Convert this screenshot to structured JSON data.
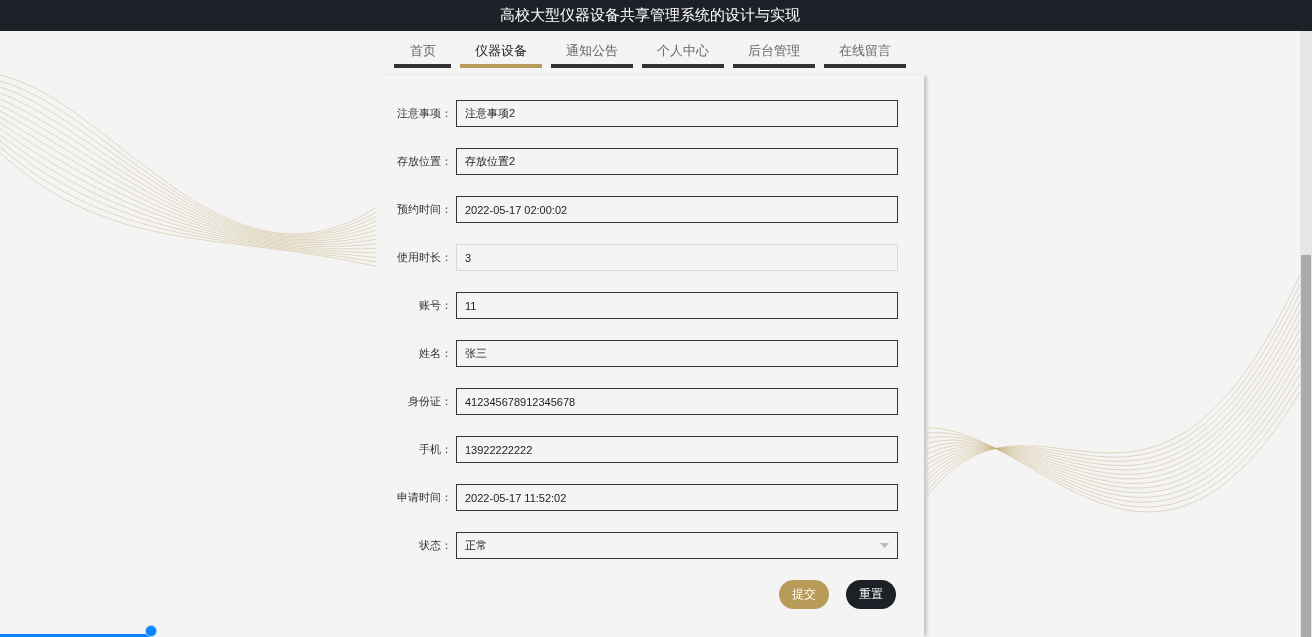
{
  "window": {
    "title": "高校大型仪器设备共享管理系统的设计与实现"
  },
  "tabs": [
    {
      "label": "首页",
      "selected": false
    },
    {
      "label": "仪器设备",
      "selected": true
    },
    {
      "label": "通知公告",
      "selected": false
    },
    {
      "label": "个人中心",
      "selected": false
    },
    {
      "label": "后台管理",
      "selected": false
    },
    {
      "label": "在线留言",
      "selected": false
    }
  ],
  "form": {
    "fields": [
      {
        "label": "注意事项：",
        "value": "注意事项2",
        "kind": "text",
        "readonly": false
      },
      {
        "label": "存放位置：",
        "value": "存放位置2",
        "kind": "text",
        "readonly": false
      },
      {
        "label": "预约时间：",
        "value": "2022-05-17 02:00:02",
        "kind": "text",
        "readonly": false
      },
      {
        "label": "使用时长：",
        "value": "3",
        "kind": "text",
        "readonly": true
      },
      {
        "label": "账号：",
        "value": "11",
        "kind": "text",
        "readonly": false
      },
      {
        "label": "姓名：",
        "value": "张三",
        "kind": "text",
        "readonly": false
      },
      {
        "label": "身份证：",
        "value": "412345678912345678",
        "kind": "text",
        "readonly": false
      },
      {
        "label": "手机：",
        "value": "13922222222",
        "kind": "text",
        "readonly": false
      },
      {
        "label": "申请时间：",
        "value": "2022-05-17 11:52:02",
        "kind": "text",
        "readonly": false
      },
      {
        "label": "状态：",
        "value": "正常",
        "kind": "select",
        "readonly": false
      }
    ],
    "buttons": [
      {
        "label": "提交",
        "kind": "primary"
      },
      {
        "label": "重置",
        "kind": "secondary"
      }
    ]
  },
  "video_progress": {
    "level": 0.116
  }
}
